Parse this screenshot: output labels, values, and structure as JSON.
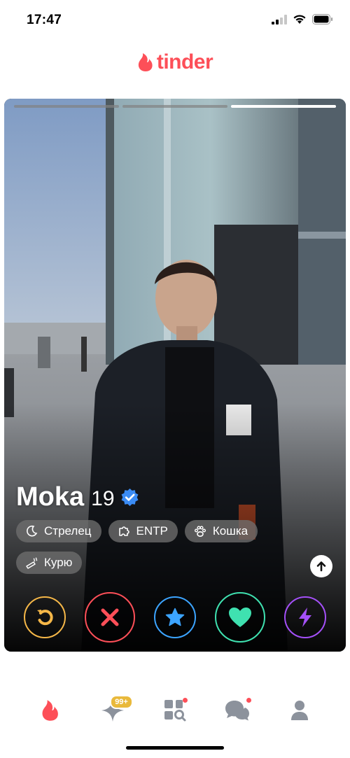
{
  "status_bar": {
    "time": "17:47"
  },
  "app": {
    "logo_text": "tinder",
    "brand_color": "#fd4f58"
  },
  "card": {
    "photo_count": 3,
    "active_photo_index": 2,
    "name": "Moka",
    "age": "19",
    "verified": true,
    "chips": [
      {
        "icon": "moon-icon",
        "label": "Стрелец"
      },
      {
        "icon": "puzzle-icon",
        "label": "ENTP"
      },
      {
        "icon": "paw-icon",
        "label": "Кошка"
      },
      {
        "icon": "cigarette-icon",
        "label": "Курю"
      }
    ]
  },
  "actions": {
    "rewind": {
      "icon": "rewind-icon",
      "color": "#f5b748"
    },
    "nope": {
      "icon": "close-icon",
      "color": "#fd4f58"
    },
    "super_like": {
      "icon": "star-icon",
      "color": "#3ca4ff"
    },
    "like": {
      "icon": "heart-icon",
      "color": "#3fe1b0"
    },
    "boost": {
      "icon": "bolt-icon",
      "color": "#a450f8"
    }
  },
  "bottom_nav": {
    "items": [
      {
        "name": "home",
        "icon": "flame-icon",
        "active": true
      },
      {
        "name": "gold",
        "icon": "sparkle-icon",
        "badge": "99+"
      },
      {
        "name": "explore",
        "icon": "explore-icon",
        "dot": true
      },
      {
        "name": "messages",
        "icon": "chat-icon",
        "dot": true
      },
      {
        "name": "profile",
        "icon": "profile-icon"
      }
    ]
  }
}
